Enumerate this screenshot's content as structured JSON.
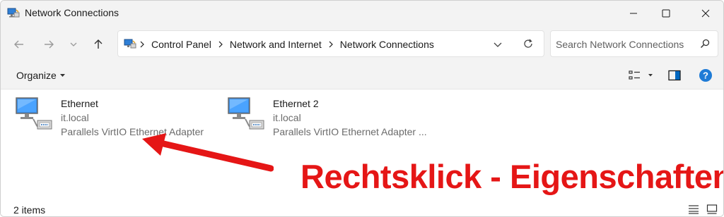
{
  "window": {
    "title": "Network Connections",
    "title_icon": "network-connections-icon"
  },
  "address_bar": {
    "icon": "control-panel-icon",
    "breadcrumbs": [
      "Control Panel",
      "Network and Internet",
      "Network Connections"
    ]
  },
  "search": {
    "placeholder": "Search Network Connections"
  },
  "toolbar": {
    "organize_label": "Organize"
  },
  "connections": [
    {
      "name": "Ethernet",
      "network": "it.local",
      "adapter": "Parallels VirtIO Ethernet Adapter",
      "icon": "network-adapter-icon"
    },
    {
      "name": "Ethernet 2",
      "network": "it.local",
      "adapter": "Parallels VirtIO Ethernet Adapter ...",
      "icon": "network-adapter-icon"
    }
  ],
  "annotation": {
    "text": "Rechtsklick - Eigenschaften",
    "color": "#e51616"
  },
  "status": {
    "item_count": "2 items"
  },
  "colors": {
    "chrome_bg": "#f3f3f3",
    "accent": "#0067c0",
    "annotation_red": "#e51616"
  }
}
